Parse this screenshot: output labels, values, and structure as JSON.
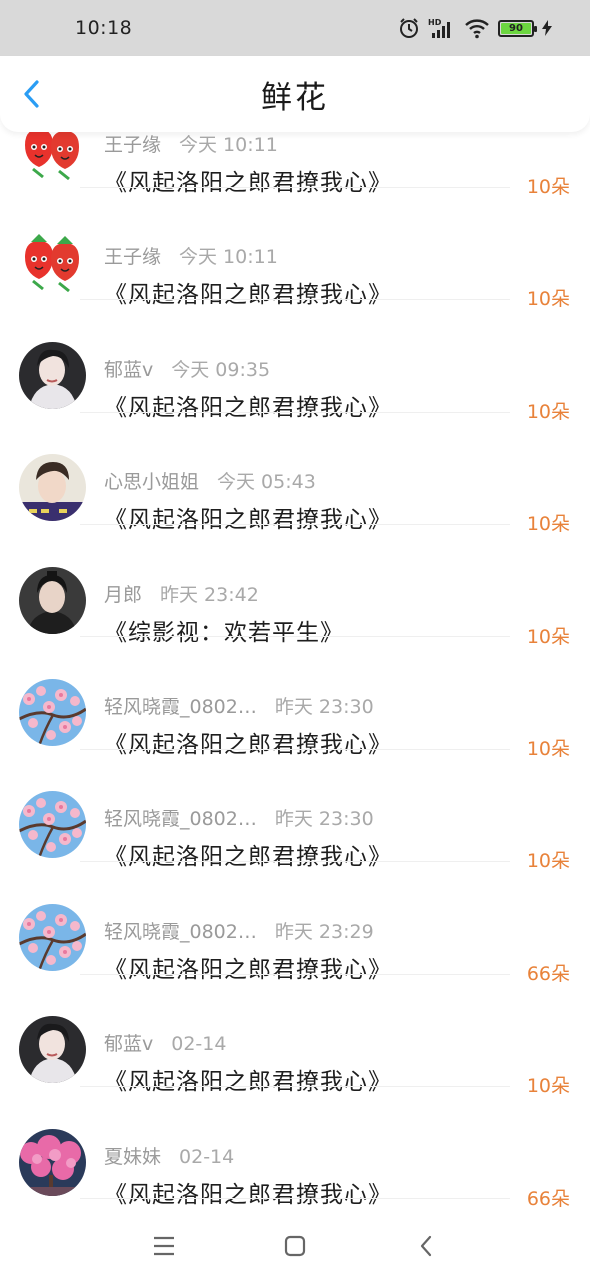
{
  "status": {
    "time": "10:18",
    "battery": "90",
    "network": "HD"
  },
  "header": {
    "title": "鲜花"
  },
  "items": [
    {
      "name": "王子缘",
      "time": "今天 10:11",
      "book": "《风起洛阳之郎君撩我心》",
      "count": "10朵",
      "avatar": "strawberry"
    },
    {
      "name": "王子缘",
      "time": "今天 10:11",
      "book": "《风起洛阳之郎君撩我心》",
      "count": "10朵",
      "avatar": "strawberry"
    },
    {
      "name": "郁蓝v",
      "time": "今天 09:35",
      "book": "《风起洛阳之郎君撩我心》",
      "count": "10朵",
      "avatar": "woman"
    },
    {
      "name": "心思小姐姐",
      "time": "今天 05:43",
      "book": "《风起洛阳之郎君撩我心》",
      "count": "10朵",
      "avatar": "boy"
    },
    {
      "name": "月郎",
      "time": "昨天 23:42",
      "book": "《综影视：欢若平生》",
      "count": "10朵",
      "avatar": "man"
    },
    {
      "name": "轻风晓霞_0802…",
      "time": "昨天 23:30",
      "book": "《风起洛阳之郎君撩我心》",
      "count": "10朵",
      "avatar": "blossom"
    },
    {
      "name": "轻风晓霞_0802…",
      "time": "昨天 23:30",
      "book": "《风起洛阳之郎君撩我心》",
      "count": "10朵",
      "avatar": "blossom"
    },
    {
      "name": "轻风晓霞_0802…",
      "time": "昨天 23:29",
      "book": "《风起洛阳之郎君撩我心》",
      "count": "66朵",
      "avatar": "blossom"
    },
    {
      "name": "郁蓝v",
      "time": "02-14",
      "book": "《风起洛阳之郎君撩我心》",
      "count": "10朵",
      "avatar": "woman"
    },
    {
      "name": "夏妹妹",
      "time": "02-14",
      "book": "《风起洛阳之郎君撩我心》",
      "count": "66朵",
      "avatar": "pinktree"
    }
  ],
  "colors": {
    "accent": "#2a9df4",
    "count": "#e8823a",
    "status_bar": "#d9d9d9"
  }
}
